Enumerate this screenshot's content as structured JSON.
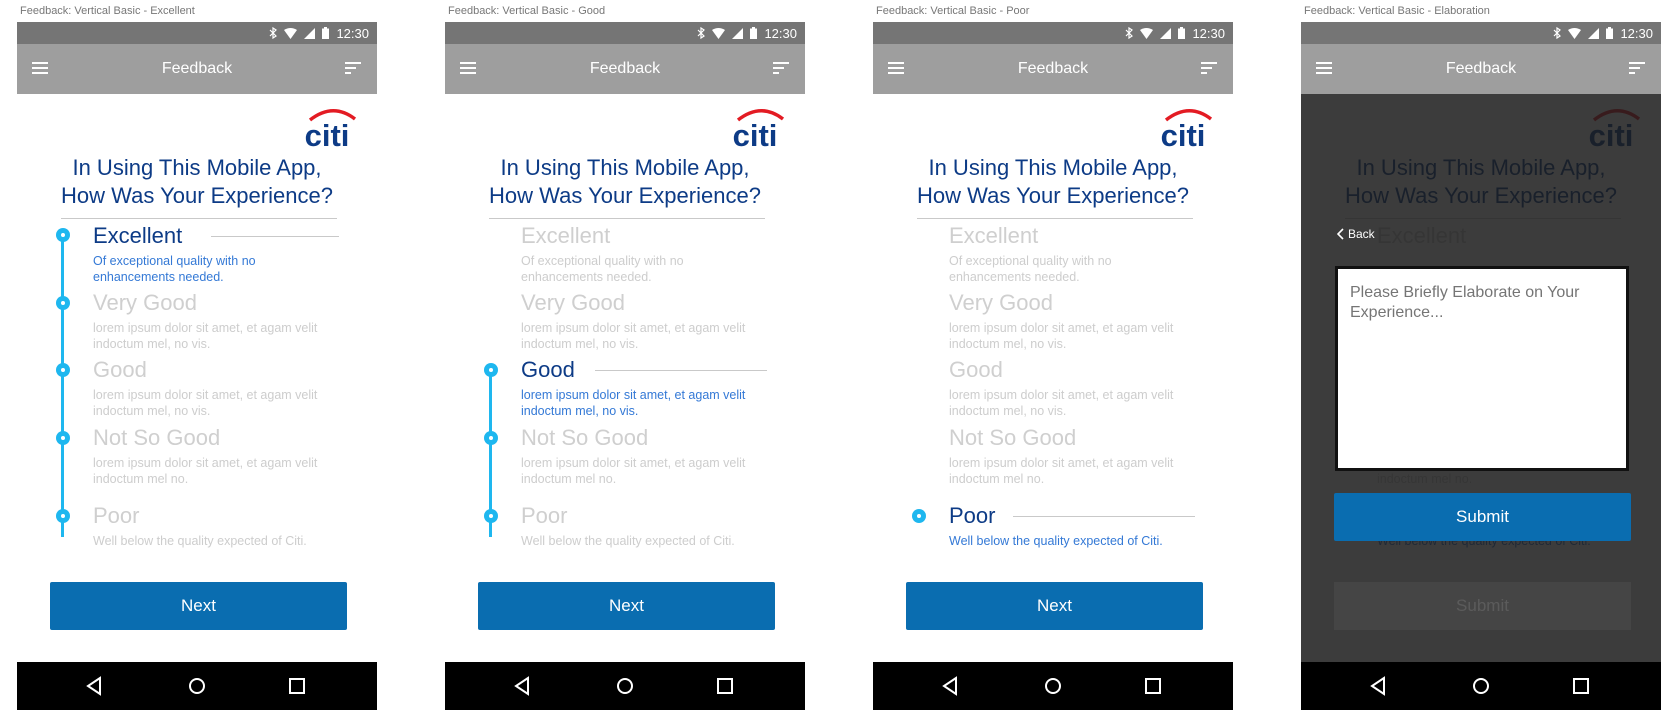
{
  "status": {
    "time": "12:30"
  },
  "app": {
    "title": "Feedback"
  },
  "logo": {
    "text": "citi",
    "arc_color": "#e31b23",
    "text_color": "#0d3b86"
  },
  "question": {
    "line1": "In Using This Mobile App,",
    "line2": "How Was Your Experience?"
  },
  "options": [
    {
      "label": "Excellent",
      "desc": "Of exceptional quality with no enhancements needed."
    },
    {
      "label": "Very Good",
      "desc": "lorem ipsum dolor sit amet, et agam velit indoctum mel, no vis."
    },
    {
      "label": "Good",
      "desc": "lorem ipsum dolor sit amet, et agam velit indoctum mel, no vis."
    },
    {
      "label": "Not So Good",
      "desc": "lorem ipsum dolor sit amet, et agam velit indoctum mel no."
    },
    {
      "label": "Poor",
      "desc": "Well below the quality expected of Citi."
    }
  ],
  "screens": [
    {
      "caption": "Feedback: Vertical Basic - Excellent",
      "selected_option": "Excellent"
    },
    {
      "caption": "Feedback: Vertical Basic - Good",
      "selected_option": "Good"
    },
    {
      "caption": "Feedback: Vertical Basic - Poor",
      "selected_option": "Poor"
    },
    {
      "caption": "Feedback: Vertical Basic - Elaboration",
      "selected_option": "Poor"
    }
  ],
  "buttons": {
    "next": "Next",
    "submit": "Submit",
    "back": "Back"
  },
  "elaboration": {
    "placeholder": "Please Briefly Elaborate on Your Experience..."
  },
  "colors": {
    "primary_button": "#0a6db0",
    "timeline": "#1eb7ef",
    "app_bar": "#9e9e9e",
    "status_bar": "#757575"
  }
}
